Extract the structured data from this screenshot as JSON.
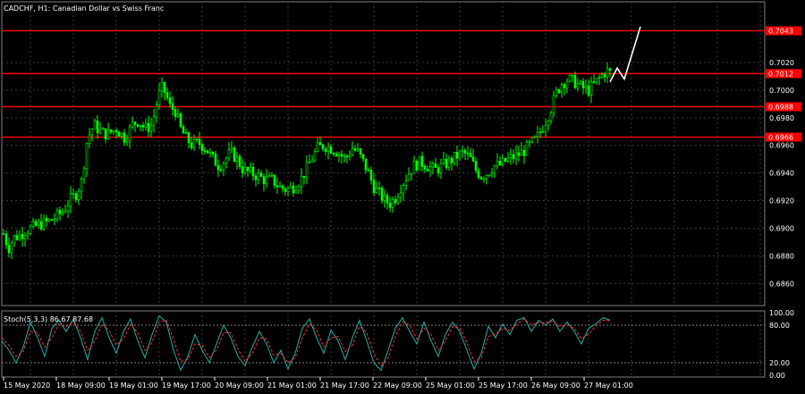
{
  "header": {
    "symbol_label": "CADCHF, H1:  Canadian Dollar vs Swiss Franc",
    "stoch_label": "Stoch(5,3,3) 86.67 87.68"
  },
  "colors": {
    "background": "#000000",
    "grid": "#3a3a3a",
    "bull_candle": "#00ff00",
    "bear_candle": "#00ff00",
    "level_line": "#ff0000",
    "projection": "#ffffff",
    "stoch_main": "#20b2aa",
    "stoch_signal": "#ff3030"
  },
  "chart_data": [
    {
      "type": "candlestick",
      "title": "CADCHF, H1:  Canadian Dollar vs Swiss Franc",
      "ylim": [
        0.6844,
        0.7064
      ],
      "y_ticks": [
        "0.7020",
        "0.7000",
        "0.6980",
        "0.6960",
        "0.6940",
        "0.6920",
        "0.6900",
        "0.6880",
        "0.6860"
      ],
      "x_ticks": [
        "15 May 2020",
        "18 May 09:00",
        "19 May 01:00",
        "19 May 17:00",
        "20 May 09:00",
        "21 May 01:00",
        "21 May 17:00",
        "22 May 09:00",
        "25 May 01:00",
        "25 May 17:00",
        "26 May 09:00",
        "27 May 01:00"
      ],
      "levels": [
        {
          "price": 0.7043,
          "label": "0.7043"
        },
        {
          "price": 0.7012,
          "label": "0.7012"
        },
        {
          "price": 0.6988,
          "label": "0.6988"
        },
        {
          "price": 0.6966,
          "label": "0.6966"
        }
      ],
      "anchors": [
        [
          0,
          0.6908
        ],
        [
          5,
          0.6893
        ],
        [
          10,
          0.6886
        ],
        [
          15,
          0.6893
        ],
        [
          22,
          0.6895
        ],
        [
          28,
          0.6898
        ],
        [
          35,
          0.69
        ],
        [
          45,
          0.6903
        ],
        [
          55,
          0.6905
        ],
        [
          62,
          0.6908
        ],
        [
          70,
          0.6912
        ],
        [
          78,
          0.692
        ],
        [
          85,
          0.6925
        ],
        [
          92,
          0.6935
        ],
        [
          96,
          0.696
        ],
        [
          100,
          0.6968
        ],
        [
          105,
          0.6975
        ],
        [
          112,
          0.697
        ],
        [
          120,
          0.6968
        ],
        [
          130,
          0.6972
        ],
        [
          140,
          0.6965
        ],
        [
          148,
          0.6975
        ],
        [
          155,
          0.6978
        ],
        [
          162,
          0.6972
        ],
        [
          170,
          0.6975
        ],
        [
          175,
          0.699
        ],
        [
          180,
          0.7002
        ],
        [
          185,
          0.6998
        ],
        [
          190,
          0.6988
        ],
        [
          196,
          0.6985
        ],
        [
          202,
          0.6972
        ],
        [
          208,
          0.6965
        ],
        [
          215,
          0.696
        ],
        [
          222,
          0.6962
        ],
        [
          230,
          0.6958
        ],
        [
          238,
          0.695
        ],
        [
          245,
          0.6945
        ],
        [
          252,
          0.695
        ],
        [
          258,
          0.6955
        ],
        [
          265,
          0.695
        ],
        [
          272,
          0.6942
        ],
        [
          280,
          0.694
        ],
        [
          288,
          0.6938
        ],
        [
          296,
          0.6935
        ],
        [
          304,
          0.6935
        ],
        [
          312,
          0.693
        ],
        [
          320,
          0.6928
        ],
        [
          328,
          0.693
        ],
        [
          336,
          0.6935
        ],
        [
          342,
          0.6942
        ],
        [
          348,
          0.695
        ],
        [
          355,
          0.6958
        ],
        [
          362,
          0.696
        ],
        [
          370,
          0.6958
        ],
        [
          378,
          0.6955
        ],
        [
          386,
          0.695
        ],
        [
          394,
          0.6958
        ],
        [
          400,
          0.6955
        ],
        [
          406,
          0.6948
        ],
        [
          412,
          0.694
        ],
        [
          418,
          0.693
        ],
        [
          424,
          0.6925
        ],
        [
          430,
          0.692
        ],
        [
          436,
          0.6918
        ],
        [
          442,
          0.6922
        ],
        [
          448,
          0.693
        ],
        [
          455,
          0.6938
        ],
        [
          462,
          0.6945
        ],
        [
          470,
          0.6948
        ],
        [
          478,
          0.6945
        ],
        [
          486,
          0.6942
        ],
        [
          494,
          0.6945
        ],
        [
          502,
          0.6948
        ],
        [
          510,
          0.6952
        ],
        [
          518,
          0.6955
        ],
        [
          526,
          0.695
        ],
        [
          532,
          0.6942
        ],
        [
          538,
          0.6938
        ],
        [
          545,
          0.694
        ],
        [
          552,
          0.6945
        ],
        [
          560,
          0.6946
        ],
        [
          568,
          0.695
        ],
        [
          576,
          0.6952
        ],
        [
          584,
          0.6955
        ],
        [
          592,
          0.696
        ],
        [
          600,
          0.6965
        ],
        [
          608,
          0.6975
        ],
        [
          615,
          0.6985
        ],
        [
          622,
          0.6998
        ],
        [
          628,
          0.7005
        ],
        [
          635,
          0.7008
        ],
        [
          642,
          0.7006
        ],
        [
          650,
          0.7002
        ],
        [
          658,
          0.7
        ],
        [
          665,
          0.7005
        ],
        [
          672,
          0.701
        ],
        [
          678,
          0.7014
        ],
        [
          684,
          0.7012
        ]
      ],
      "projection_path": [
        [
          682,
          0.7006
        ],
        [
          690,
          0.7016
        ],
        [
          698,
          0.7008
        ],
        [
          716,
          0.7046
        ]
      ],
      "stoch": {
        "ylim": [
          0,
          100
        ],
        "y_ticks": [
          "100.00",
          "80.00",
          "20.00",
          "0.00"
        ],
        "main": [
          [
            2,
            55
          ],
          [
            10,
            40
          ],
          [
            18,
            20
          ],
          [
            26,
            45
          ],
          [
            34,
            85
          ],
          [
            42,
            60
          ],
          [
            50,
            30
          ],
          [
            58,
            75
          ],
          [
            66,
            88
          ],
          [
            74,
            70
          ],
          [
            82,
            90
          ],
          [
            90,
            60
          ],
          [
            98,
            25
          ],
          [
            106,
            70
          ],
          [
            114,
            92
          ],
          [
            122,
            60
          ],
          [
            130,
            35
          ],
          [
            138,
            70
          ],
          [
            146,
            90
          ],
          [
            154,
            55
          ],
          [
            162,
            28
          ],
          [
            170,
            65
          ],
          [
            178,
            95
          ],
          [
            186,
            85
          ],
          [
            194,
            40
          ],
          [
            202,
            8
          ],
          [
            210,
            30
          ],
          [
            218,
            65
          ],
          [
            226,
            40
          ],
          [
            234,
            20
          ],
          [
            242,
            50
          ],
          [
            250,
            80
          ],
          [
            258,
            60
          ],
          [
            266,
            30
          ],
          [
            274,
            15
          ],
          [
            282,
            45
          ],
          [
            290,
            70
          ],
          [
            298,
            50
          ],
          [
            306,
            20
          ],
          [
            314,
            40
          ],
          [
            322,
            10
          ],
          [
            330,
            35
          ],
          [
            338,
            75
          ],
          [
            346,
            90
          ],
          [
            354,
            60
          ],
          [
            362,
            35
          ],
          [
            370,
            72
          ],
          [
            378,
            55
          ],
          [
            386,
            25
          ],
          [
            394,
            60
          ],
          [
            402,
            88
          ],
          [
            410,
            55
          ],
          [
            418,
            20
          ],
          [
            426,
            8
          ],
          [
            434,
            40
          ],
          [
            442,
            75
          ],
          [
            450,
            92
          ],
          [
            458,
            70
          ],
          [
            466,
            50
          ],
          [
            474,
            85
          ],
          [
            482,
            55
          ],
          [
            490,
            30
          ],
          [
            498,
            65
          ],
          [
            506,
            85
          ],
          [
            514,
            70
          ],
          [
            522,
            40
          ],
          [
            530,
            10
          ],
          [
            538,
            35
          ],
          [
            546,
            78
          ],
          [
            554,
            60
          ],
          [
            562,
            82
          ],
          [
            570,
            65
          ],
          [
            578,
            88
          ],
          [
            586,
            92
          ],
          [
            594,
            70
          ],
          [
            602,
            88
          ],
          [
            610,
            80
          ],
          [
            618,
            90
          ],
          [
            626,
            70
          ],
          [
            634,
            85
          ],
          [
            642,
            70
          ],
          [
            650,
            50
          ],
          [
            658,
            75
          ],
          [
            666,
            82
          ],
          [
            674,
            92
          ],
          [
            682,
            88
          ]
        ],
        "signal": [
          [
            2,
            60
          ],
          [
            10,
            48
          ],
          [
            18,
            30
          ],
          [
            26,
            38
          ],
          [
            34,
            70
          ],
          [
            42,
            68
          ],
          [
            50,
            45
          ],
          [
            58,
            60
          ],
          [
            66,
            82
          ],
          [
            74,
            78
          ],
          [
            82,
            85
          ],
          [
            90,
            70
          ],
          [
            98,
            40
          ],
          [
            106,
            55
          ],
          [
            114,
            82
          ],
          [
            122,
            72
          ],
          [
            130,
            48
          ],
          [
            138,
            58
          ],
          [
            146,
            82
          ],
          [
            154,
            68
          ],
          [
            162,
            40
          ],
          [
            170,
            52
          ],
          [
            178,
            85
          ],
          [
            186,
            88
          ],
          [
            194,
            58
          ],
          [
            202,
            22
          ],
          [
            210,
            25
          ],
          [
            218,
            50
          ],
          [
            226,
            48
          ],
          [
            234,
            28
          ],
          [
            242,
            40
          ],
          [
            250,
            68
          ],
          [
            258,
            68
          ],
          [
            266,
            42
          ],
          [
            274,
            22
          ],
          [
            282,
            35
          ],
          [
            290,
            60
          ],
          [
            298,
            58
          ],
          [
            306,
            32
          ],
          [
            314,
            35
          ],
          [
            322,
            20
          ],
          [
            330,
            28
          ],
          [
            338,
            60
          ],
          [
            346,
            82
          ],
          [
            354,
            72
          ],
          [
            362,
            45
          ],
          [
            370,
            60
          ],
          [
            378,
            62
          ],
          [
            386,
            38
          ],
          [
            394,
            48
          ],
          [
            402,
            78
          ],
          [
            410,
            68
          ],
          [
            418,
            35
          ],
          [
            426,
            15
          ],
          [
            434,
            28
          ],
          [
            442,
            62
          ],
          [
            450,
            85
          ],
          [
            458,
            80
          ],
          [
            466,
            58
          ],
          [
            474,
            75
          ],
          [
            482,
            65
          ],
          [
            490,
            40
          ],
          [
            498,
            55
          ],
          [
            506,
            78
          ],
          [
            514,
            76
          ],
          [
            522,
            52
          ],
          [
            530,
            22
          ],
          [
            538,
            28
          ],
          [
            546,
            62
          ],
          [
            554,
            66
          ],
          [
            562,
            75
          ],
          [
            570,
            72
          ],
          [
            578,
            82
          ],
          [
            586,
            90
          ],
          [
            594,
            80
          ],
          [
            602,
            84
          ],
          [
            610,
            84
          ],
          [
            618,
            86
          ],
          [
            626,
            78
          ],
          [
            634,
            80
          ],
          [
            642,
            75
          ],
          [
            650,
            58
          ],
          [
            658,
            66
          ],
          [
            666,
            78
          ],
          [
            674,
            88
          ],
          [
            682,
            87
          ]
        ]
      }
    }
  ]
}
